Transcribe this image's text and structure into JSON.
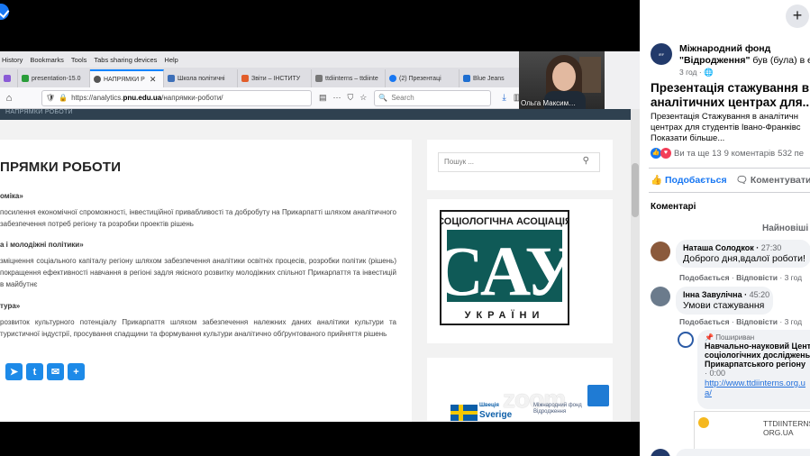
{
  "browser": {
    "menu": [
      "History",
      "Bookmarks",
      "Tools",
      "Tabs sharing devices",
      "Help"
    ],
    "tabs": [
      {
        "label": "presentation-15.0",
        "color": "#2a9d3a",
        "active": false
      },
      {
        "label": "НАПРЯМКИ Р",
        "color": "#555555",
        "active": true
      },
      {
        "label": "Школа політичні",
        "color": "#3d6fb8",
        "active": false
      },
      {
        "label": "Звіти – ІНСТИТУ",
        "color": "#e25d2a",
        "active": false
      },
      {
        "label": "ttdiinterns – ttdiinte",
        "color": "#777777",
        "active": false
      },
      {
        "label": "(2) Презентаці",
        "color": "#1877f2",
        "active": false
      },
      {
        "label": "Blue Jeans",
        "color": "#1f6fd1",
        "active": false
      }
    ],
    "url": {
      "prefix": "https://analytics.",
      "domain": "pnu.edu.ua",
      "path": "/напрямки-роботи/"
    },
    "search_placeholder": "Search"
  },
  "webcam": {
    "name": "Ольга Максим…"
  },
  "site": {
    "header_text": "НАПРЯМКИ РОБОТИ",
    "title": "ПРЯМКИ РОБОТИ",
    "sections": [
      {
        "heading": "оміка»",
        "text": "посилення економічної спроможності, інвестиційної привабливості та добробуту на Прикарпатті шляхом аналітичного забезпечення потреб регіону  та розробки проектів рішень"
      },
      {
        "heading": "а і молодіжні політики»",
        "text": "зміцнення соціального капіталу регіону шляхом забезпечення аналітики освітніх процесів, розробки політик (рішень) покращення ефективності навчання в регіоні задля якісного розвитку молодіжних спільнот Прикарпаття та інвестицій в майбутнє"
      },
      {
        "heading": "тура»",
        "text": "розвиток культурного потенціалу Прикарпаття шляхом забезпечення належних даних аналітики культури та туристичної індустрії, просування спадщини та формування культури аналітично обґрунтованого прийняття рішень"
      }
    ],
    "search_placeholder": "Пошук ...",
    "logo": {
      "top": "СОЦІОЛОГІЧНА АСОЦІАЦІЯ",
      "mark": "САУ",
      "bottom": "УКРАЇНИ"
    },
    "sponsor": {
      "sweden_small": "Швеція",
      "sweden_big": "Sverige",
      "irf": "Міжнародний фонд Відродження"
    },
    "zoom_watermark": "zoom"
  },
  "fb": {
    "page_name_1": "Міжнародний фонд",
    "page_name_2": "\"Відродження\"",
    "page_name_rest": " був (була) в ефі",
    "post_time": "3 год · ",
    "title_1": "Презентація стажування в",
    "title_2": "аналітичних центрах для...",
    "desc_1": "Презентація Стажування в аналітичн",
    "desc_2": "центрах для студентів Івано-Франківс",
    "desc_3": "Показати більше...",
    "reactions_text": "Ви та ще 13",
    "comments_count": "9 коментарів",
    "views": "532 пе",
    "like_label": "Подобається",
    "comment_label": "Коментувати",
    "comments_header": "Коментарі",
    "sort_label": "Найновіші",
    "comments": [
      {
        "name": "Наташа Солодкок",
        "time": "27:30",
        "text": "Доброго дня,вдалої роботи!",
        "like": "Подобається",
        "reply": "Відповісти",
        "ago": "3 год"
      },
      {
        "name": "Інна Завулічна",
        "time": "45:20",
        "text": "Умови стажування",
        "like": "Подобається",
        "reply": "Відповісти",
        "ago": "3 год"
      }
    ],
    "pinned": {
      "label": "Пошириван",
      "author_1": "Навчально-науковий Центр",
      "author_2": "соціологічних досліджень",
      "author_3": "Прикарпатського регіону",
      "time": "· 0:00",
      "link_1": "http://www.ttdiinterns.org.u",
      "link_2": "a/",
      "preview_1": "TTDIINTERNS",
      "preview_2": "ORG.UA"
    }
  }
}
